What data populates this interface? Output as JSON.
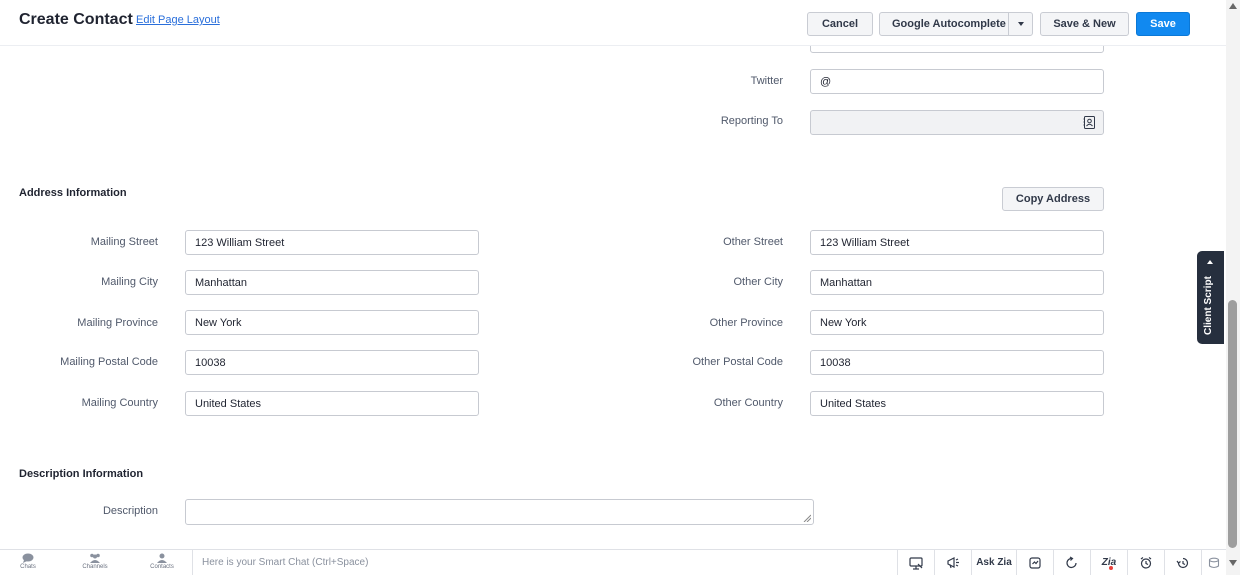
{
  "header": {
    "title": "Create Contact",
    "edit_layout_link": "Edit Page Layout",
    "buttons": {
      "cancel": "Cancel",
      "google_autocomplete": "Google Autocomplete",
      "save_new": "Save & New",
      "save": "Save"
    }
  },
  "social": {
    "twitter_label": "Twitter",
    "twitter_value": "@",
    "reporting_to_label": "Reporting To",
    "reporting_to_value": ""
  },
  "address": {
    "section_title": "Address Information",
    "copy_button": "Copy Address",
    "mailing": [
      {
        "label": "Mailing Street",
        "value": "123 William Street"
      },
      {
        "label": "Mailing City",
        "value": "Manhattan"
      },
      {
        "label": "Mailing Province",
        "value": "New York"
      },
      {
        "label": "Mailing Postal Code",
        "value": "10038"
      },
      {
        "label": "Mailing Country",
        "value": "United States"
      }
    ],
    "other": [
      {
        "label": "Other Street",
        "value": "123 William Street"
      },
      {
        "label": "Other City",
        "value": "Manhattan"
      },
      {
        "label": "Other Province",
        "value": "New York"
      },
      {
        "label": "Other Postal Code",
        "value": "10038"
      },
      {
        "label": "Other Country",
        "value": "United States"
      }
    ]
  },
  "description": {
    "section_title": "Description Information",
    "label": "Description",
    "value": ""
  },
  "client_script": {
    "label": "Client Script"
  },
  "bottom_bar": {
    "chats": "Chats",
    "channels": "Channels",
    "contacts": "Contacts",
    "smart_chat_placeholder": "Here is your Smart Chat (Ctrl+Space)",
    "ask_zia": "Ask Zia",
    "zia": "Zia"
  },
  "colors": {
    "primary": "#1189f0",
    "link": "#2a6fdb",
    "client_script_bg": "#262f3e"
  }
}
